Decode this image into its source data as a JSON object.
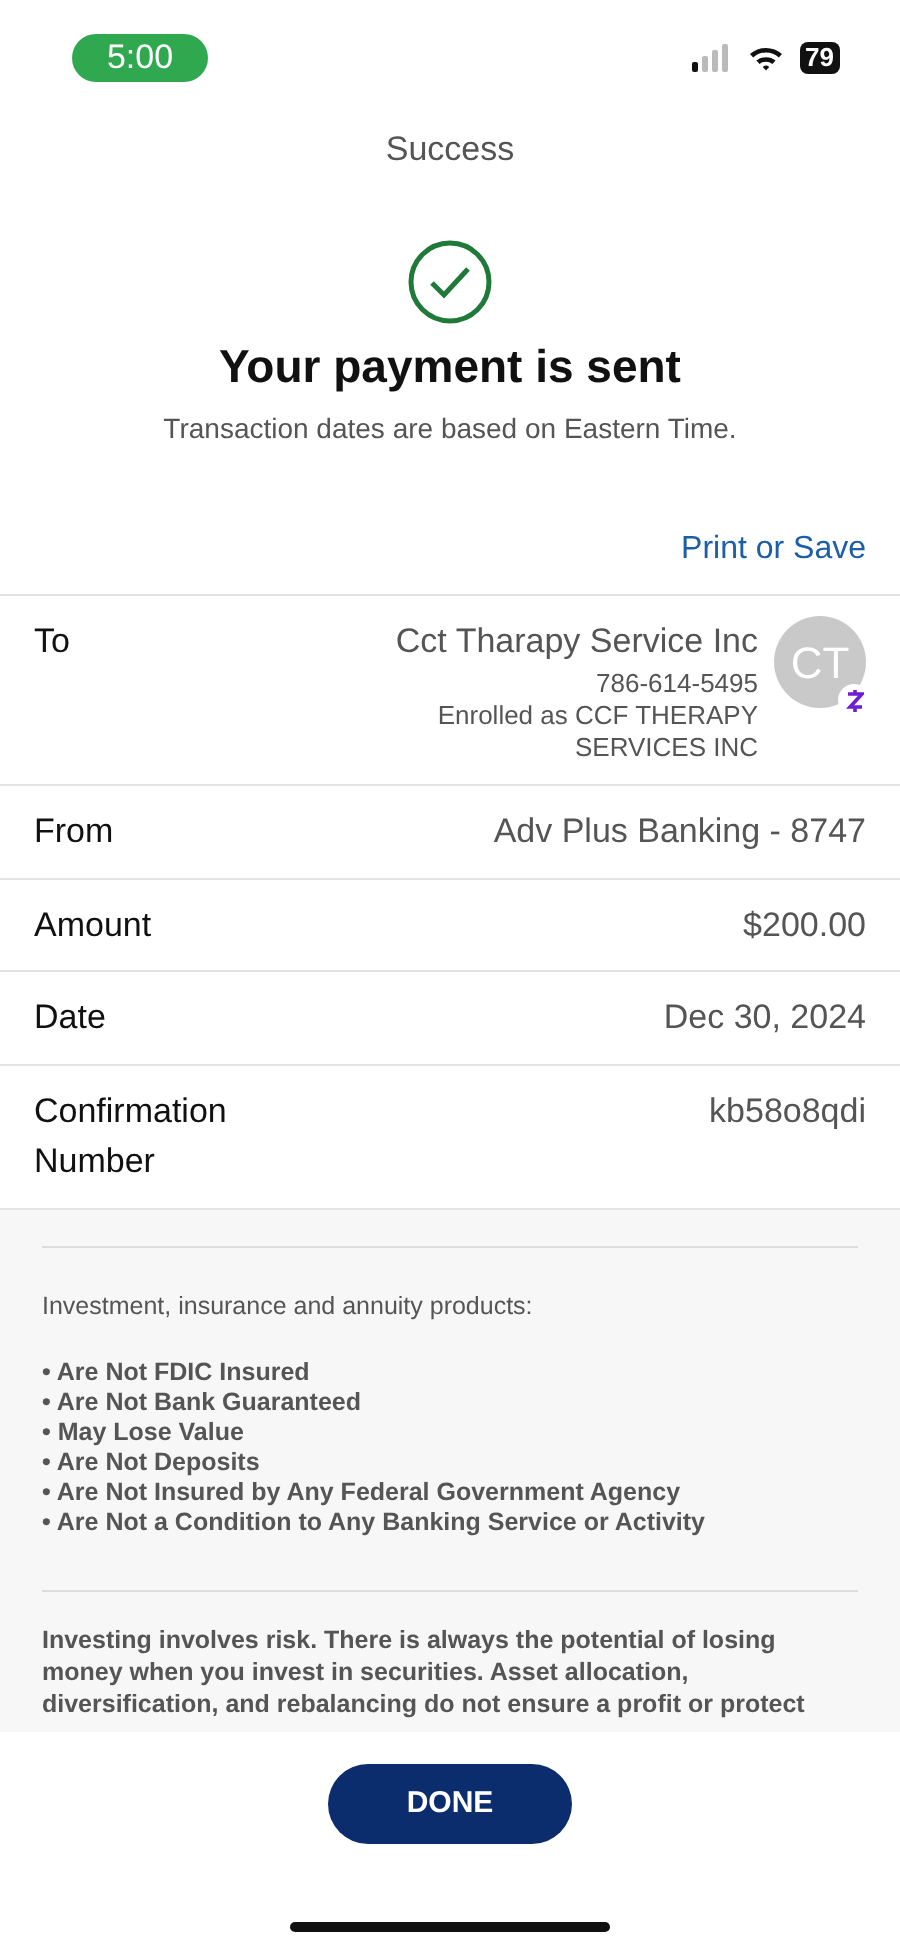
{
  "status_bar": {
    "time": "5:00",
    "battery": "79"
  },
  "header": {
    "title": "Success"
  },
  "confirmation": {
    "heading": "Your payment is sent",
    "note": "Transaction dates are based on Eastern Time.",
    "link": "Print or Save"
  },
  "details": [
    {
      "kind": "payee",
      "label": "To",
      "value": "Cct Tharapy Service Inc",
      "phone": "786-614-5495",
      "enrolled": "Enrolled as CCF THERAPY SERVICES INC",
      "avatar": "CT"
    },
    {
      "kind": "plain",
      "label": "From",
      "value": "Adv Plus Banking - 8747"
    },
    {
      "kind": "plain",
      "label": "Amount",
      "value": "$200.00"
    },
    {
      "kind": "plain",
      "label": "Date",
      "value": "Dec 30, 2024"
    },
    {
      "kind": "plain",
      "label": "Confirmation Number",
      "value": "kb58o8qdi"
    }
  ],
  "disclosure": {
    "intro": "Investment, insurance and annuity products:",
    "bullets": [
      "• Are Not FDIC Insured",
      "• Are Not Bank Guaranteed",
      "• May Lose Value",
      "• Are Not Deposits",
      "• Are Not Insured by Any Federal Government Agency",
      "• Are Not a Condition to Any Banking Service or Activity"
    ],
    "paragraph": "Investing involves risk. There is always the potential of losing money when you invest in securities. Asset allocation, diversification, and rebalancing do not ensure a profit or protect"
  },
  "done_button": "DONE"
}
